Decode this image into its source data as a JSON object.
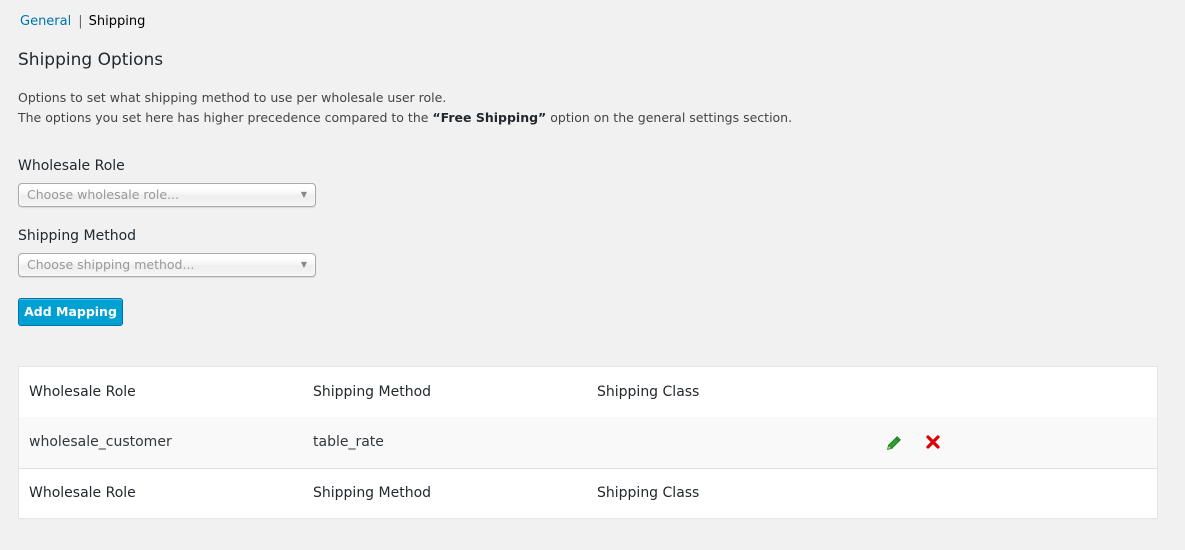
{
  "subnav": {
    "general": "General",
    "separator": "|",
    "shipping": "Shipping"
  },
  "section": {
    "title": "Shipping Options",
    "desc_line1": "Options to set what shipping method to use per wholesale user role.",
    "desc_line2_pre": "The options you set here has higher precedence compared to the ",
    "desc_line2_bold": "“Free Shipping”",
    "desc_line2_post": " option on the general settings section."
  },
  "form": {
    "role_label": "Wholesale Role",
    "role_placeholder": "Choose wholesale role...",
    "method_label": "Shipping Method",
    "method_placeholder": "Choose shipping method...",
    "add_button": "Add Mapping"
  },
  "table": {
    "headers": [
      "Wholesale Role",
      "Shipping Method",
      "Shipping Class"
    ],
    "rows": [
      {
        "role": "wholesale_customer",
        "method": "table_rate",
        "class": ""
      }
    ],
    "footers": [
      "Wholesale Role",
      "Shipping Method",
      "Shipping Class"
    ]
  },
  "colors": {
    "accent": "#00a0d2",
    "link": "#0073aa",
    "edit": "#1e8a1e",
    "delete": "#dd0000"
  },
  "icons": {
    "dropdown": "triangle-down",
    "edit": "pencil-icon",
    "delete": "x-icon"
  }
}
